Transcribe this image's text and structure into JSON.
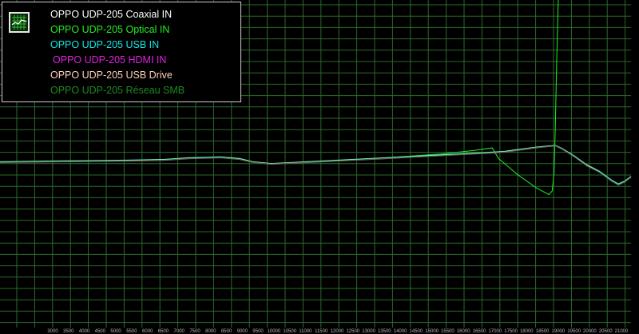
{
  "chart_data": {
    "type": "line",
    "title": "",
    "xlabel": "",
    "ylabel": "",
    "background": "#000000",
    "grid": true,
    "grid_color": "#2c6a2c",
    "legend_placement": "top-left",
    "x_ticks": [
      "3000",
      "3500",
      "4000",
      "4500",
      "5000",
      "5500",
      "6000",
      "6500",
      "7000",
      "7500",
      "8000",
      "8500",
      "9000",
      "9500",
      "10000",
      "10500",
      "11000",
      "11500",
      "12000",
      "12500",
      "13000",
      "13500",
      "14000",
      "14500",
      "15000",
      "15500",
      "16000",
      "16500",
      "17000",
      "17500",
      "18000",
      "18500",
      "19000",
      "19500",
      "20000",
      "20500",
      "21000"
    ],
    "series": [
      {
        "name": "OPPO UDP-205 Coaxial IN",
        "color": "#ffffff",
        "x": [
          0.0,
          0.1,
          0.2,
          0.26,
          0.3,
          0.35,
          0.38,
          0.4,
          0.43,
          0.5,
          0.6,
          0.7,
          0.78,
          0.8,
          0.85,
          0.87,
          0.88,
          0.89,
          0.91,
          0.93,
          0.95,
          0.97,
          0.98,
          0.99,
          1.0
        ],
        "y": [
          0.0,
          0.3,
          0.6,
          1.0,
          1.8,
          2.2,
          1.4,
          0.0,
          -0.9,
          0.1,
          1.7,
          3.3,
          4.6,
          5.0,
          7.1,
          7.7,
          8.0,
          6.6,
          2.8,
          -1.6,
          -4.7,
          -9.1,
          -10.8,
          -9.4,
          -7.1
        ]
      },
      {
        "name": "OPPO UDP-205 Optical IN",
        "color": "#22ee22",
        "x": [
          0.0,
          0.1,
          0.2,
          0.26,
          0.3,
          0.35,
          0.38,
          0.4,
          0.43,
          0.5,
          0.6,
          0.7,
          0.75,
          0.78,
          0.79,
          0.82,
          0.85,
          0.87,
          0.875,
          0.878,
          0.88,
          0.882,
          0.885,
          0.89,
          0.9
        ],
        "y": [
          0.0,
          0.4,
          0.7,
          1.1,
          1.9,
          2.3,
          1.5,
          0.1,
          -0.8,
          0.2,
          1.9,
          4.0,
          5.6,
          6.9,
          1.8,
          -5.9,
          -12.4,
          -15.6,
          -13.8,
          -5.4,
          16.2,
          46.2,
          84.2,
          120.0,
          120.0
        ]
      },
      {
        "name": "OPPO UDP-205 USB IN",
        "color": "#11e6e6",
        "x": [
          0.0,
          0.1,
          0.2,
          0.26,
          0.3,
          0.35,
          0.38,
          0.4,
          0.43,
          0.5,
          0.6,
          0.7,
          0.78,
          0.8,
          0.85,
          0.87,
          0.88,
          0.89,
          0.91,
          0.93,
          0.95,
          0.97,
          0.98,
          0.99,
          1.0
        ],
        "y": [
          0.3,
          0.7,
          1.0,
          1.4,
          2.2,
          2.6,
          1.8,
          0.3,
          -0.6,
          0.5,
          2.0,
          3.6,
          4.9,
          5.3,
          7.3,
          7.9,
          8.1,
          6.8,
          3.1,
          -1.2,
          -4.3,
          -8.7,
          -10.4,
          -9.0,
          -6.8
        ]
      },
      {
        "name": "OPPO UDP-205 HDMI IN",
        "color": "#e020e0",
        "x": [
          0.0,
          0.1,
          0.2,
          0.26,
          0.3,
          0.35,
          0.38,
          0.4,
          0.43,
          0.5,
          0.6,
          0.7,
          0.78,
          0.8,
          0.85,
          0.87,
          0.88,
          0.89,
          0.91,
          0.93,
          0.95,
          0.97,
          0.98,
          0.99,
          1.0
        ],
        "y": [
          -0.2,
          0.2,
          0.5,
          0.9,
          1.7,
          2.1,
          1.3,
          -0.1,
          -1.0,
          0.0,
          1.5,
          3.1,
          4.4,
          4.8,
          6.9,
          7.5,
          7.8,
          6.4,
          2.6,
          -1.8,
          -4.9,
          -9.3,
          -11.0,
          -9.6,
          -7.3
        ]
      },
      {
        "name": "OPPO UDP-205 USB Drive",
        "color": "#ffd0b8",
        "x": [
          0.0,
          0.1,
          0.2,
          0.26,
          0.3,
          0.35,
          0.38,
          0.4,
          0.43,
          0.5,
          0.6,
          0.7,
          0.78,
          0.8,
          0.85,
          0.87,
          0.88,
          0.89,
          0.91,
          0.93,
          0.95,
          0.97,
          0.98,
          0.99,
          1.0
        ],
        "y": [
          0.1,
          0.5,
          0.8,
          1.2,
          2.0,
          2.4,
          1.6,
          0.2,
          -0.7,
          0.3,
          1.8,
          3.4,
          4.7,
          5.1,
          7.2,
          7.8,
          8.0,
          6.7,
          2.9,
          -1.4,
          -4.6,
          -9.0,
          -10.7,
          -9.3,
          -7.0
        ]
      },
      {
        "name": "OPPO UDP-205 Réseau SMB",
        "color": "#1e8a1e",
        "x": [
          0.0,
          0.1,
          0.2,
          0.26,
          0.3,
          0.35,
          0.38,
          0.4,
          0.43,
          0.5,
          0.6,
          0.7,
          0.78,
          0.8,
          0.85,
          0.87,
          0.88,
          0.89,
          0.91,
          0.93,
          0.95,
          0.97,
          0.98,
          0.99,
          1.0
        ],
        "y": [
          -0.1,
          0.3,
          0.6,
          1.0,
          1.8,
          2.2,
          1.4,
          0.0,
          -0.9,
          0.1,
          1.6,
          3.2,
          4.5,
          4.9,
          7.0,
          7.6,
          7.9,
          6.5,
          2.7,
          -1.7,
          -4.8,
          -9.2,
          -10.9,
          -9.5,
          -7.2
        ]
      }
    ]
  }
}
